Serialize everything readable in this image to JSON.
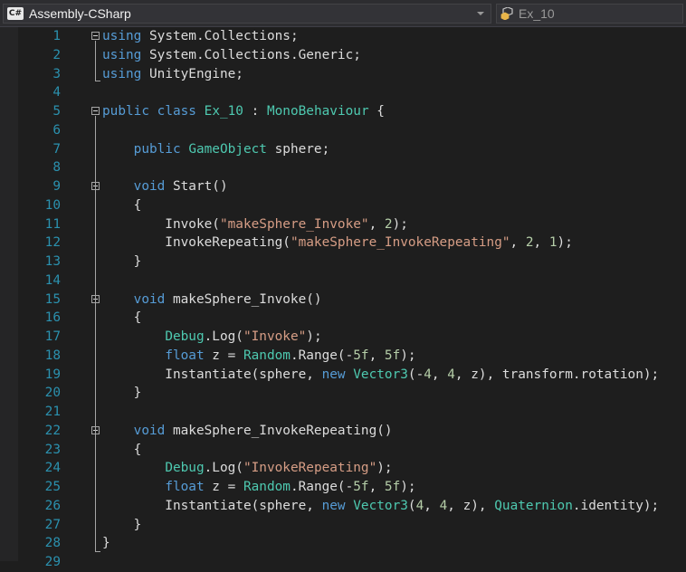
{
  "navbar": {
    "project_icon": "csharp-icon",
    "project_name": "Assembly-CSharp",
    "member_icon": "class-member-icon",
    "member_name": "Ex_10"
  },
  "colors": {
    "background": "#1e1e1e",
    "keyword": "#569cd6",
    "type": "#4ec9b0",
    "string": "#d69d85",
    "number": "#b5cea8",
    "line_number": "#2b91af",
    "text": "#dcdcdc"
  },
  "code_lines": [
    {
      "n": 1,
      "fold": true,
      "tokens": [
        {
          "t": "using",
          "c": "kw"
        },
        {
          "t": " System.Collections;"
        }
      ]
    },
    {
      "n": 2,
      "fold": false,
      "tokens": [
        {
          "t": "using",
          "c": "kw"
        },
        {
          "t": " System.Collections.Generic;"
        }
      ]
    },
    {
      "n": 3,
      "fold": false,
      "tokens": [
        {
          "t": "using",
          "c": "kw"
        },
        {
          "t": " UnityEngine;"
        }
      ]
    },
    {
      "n": 4,
      "fold": false,
      "tokens": []
    },
    {
      "n": 5,
      "fold": true,
      "tokens": [
        {
          "t": "public",
          "c": "kw"
        },
        {
          "t": " "
        },
        {
          "t": "class",
          "c": "kw"
        },
        {
          "t": " "
        },
        {
          "t": "Ex_10",
          "c": "ty"
        },
        {
          "t": " : "
        },
        {
          "t": "MonoBehaviour",
          "c": "ty"
        },
        {
          "t": " {"
        }
      ]
    },
    {
      "n": 6,
      "fold": false,
      "tokens": []
    },
    {
      "n": 7,
      "fold": false,
      "tokens": [
        {
          "t": "    "
        },
        {
          "t": "public",
          "c": "kw"
        },
        {
          "t": " "
        },
        {
          "t": "GameObject",
          "c": "ty"
        },
        {
          "t": " sphere;"
        }
      ]
    },
    {
      "n": 8,
      "fold": false,
      "tokens": []
    },
    {
      "n": 9,
      "fold": true,
      "tokens": [
        {
          "t": "    "
        },
        {
          "t": "void",
          "c": "kw"
        },
        {
          "t": " Start()"
        }
      ]
    },
    {
      "n": 10,
      "fold": false,
      "tokens": [
        {
          "t": "    {"
        }
      ]
    },
    {
      "n": 11,
      "fold": false,
      "tokens": [
        {
          "t": "        Invoke("
        },
        {
          "t": "\"makeSphere_Invoke\"",
          "c": "st"
        },
        {
          "t": ", "
        },
        {
          "t": "2",
          "c": "nu"
        },
        {
          "t": ");"
        }
      ]
    },
    {
      "n": 12,
      "fold": false,
      "tokens": [
        {
          "t": "        InvokeRepeating("
        },
        {
          "t": "\"makeSphere_InvokeRepeating\"",
          "c": "st"
        },
        {
          "t": ", "
        },
        {
          "t": "2",
          "c": "nu"
        },
        {
          "t": ", "
        },
        {
          "t": "1",
          "c": "nu"
        },
        {
          "t": ");"
        }
      ]
    },
    {
      "n": 13,
      "fold": false,
      "tokens": [
        {
          "t": "    }"
        }
      ]
    },
    {
      "n": 14,
      "fold": false,
      "tokens": []
    },
    {
      "n": 15,
      "fold": true,
      "tokens": [
        {
          "t": "    "
        },
        {
          "t": "void",
          "c": "kw"
        },
        {
          "t": " makeSphere_Invoke()"
        }
      ]
    },
    {
      "n": 16,
      "fold": false,
      "tokens": [
        {
          "t": "    {"
        }
      ]
    },
    {
      "n": 17,
      "fold": false,
      "tokens": [
        {
          "t": "        "
        },
        {
          "t": "Debug",
          "c": "ty"
        },
        {
          "t": ".Log("
        },
        {
          "t": "\"Invoke\"",
          "c": "st"
        },
        {
          "t": ");"
        }
      ]
    },
    {
      "n": 18,
      "fold": false,
      "tokens": [
        {
          "t": "        "
        },
        {
          "t": "float",
          "c": "kw"
        },
        {
          "t": " z = "
        },
        {
          "t": "Random",
          "c": "ty"
        },
        {
          "t": ".Range(-"
        },
        {
          "t": "5f",
          "c": "nu"
        },
        {
          "t": ", "
        },
        {
          "t": "5f",
          "c": "nu"
        },
        {
          "t": ");"
        }
      ]
    },
    {
      "n": 19,
      "fold": false,
      "tokens": [
        {
          "t": "        Instantiate(sphere, "
        },
        {
          "t": "new",
          "c": "kw"
        },
        {
          "t": " "
        },
        {
          "t": "Vector3",
          "c": "ty"
        },
        {
          "t": "(-"
        },
        {
          "t": "4",
          "c": "nu"
        },
        {
          "t": ", "
        },
        {
          "t": "4",
          "c": "nu"
        },
        {
          "t": ", z), transform.rotation);"
        }
      ]
    },
    {
      "n": 20,
      "fold": false,
      "tokens": [
        {
          "t": "    }"
        }
      ]
    },
    {
      "n": 21,
      "fold": false,
      "tokens": []
    },
    {
      "n": 22,
      "fold": true,
      "tokens": [
        {
          "t": "    "
        },
        {
          "t": "void",
          "c": "kw"
        },
        {
          "t": " makeSphere_InvokeRepeating()"
        }
      ]
    },
    {
      "n": 23,
      "fold": false,
      "tokens": [
        {
          "t": "    {"
        }
      ]
    },
    {
      "n": 24,
      "fold": false,
      "tokens": [
        {
          "t": "        "
        },
        {
          "t": "Debug",
          "c": "ty"
        },
        {
          "t": ".Log("
        },
        {
          "t": "\"InvokeRepeating\"",
          "c": "st"
        },
        {
          "t": ");"
        }
      ]
    },
    {
      "n": 25,
      "fold": false,
      "tokens": [
        {
          "t": "        "
        },
        {
          "t": "float",
          "c": "kw"
        },
        {
          "t": " z = "
        },
        {
          "t": "Random",
          "c": "ty"
        },
        {
          "t": ".Range(-"
        },
        {
          "t": "5f",
          "c": "nu"
        },
        {
          "t": ", "
        },
        {
          "t": "5f",
          "c": "nu"
        },
        {
          "t": ");"
        }
      ]
    },
    {
      "n": 26,
      "fold": false,
      "tokens": [
        {
          "t": "        Instantiate(sphere, "
        },
        {
          "t": "new",
          "c": "kw"
        },
        {
          "t": " "
        },
        {
          "t": "Vector3",
          "c": "ty"
        },
        {
          "t": "("
        },
        {
          "t": "4",
          "c": "nu"
        },
        {
          "t": ", "
        },
        {
          "t": "4",
          "c": "nu"
        },
        {
          "t": ", z), "
        },
        {
          "t": "Quaternion",
          "c": "ty"
        },
        {
          "t": ".identity);"
        }
      ]
    },
    {
      "n": 27,
      "fold": false,
      "tokens": [
        {
          "t": "    }"
        }
      ]
    },
    {
      "n": 28,
      "fold": false,
      "tokens": [
        {
          "t": "}"
        }
      ]
    },
    {
      "n": 29,
      "fold": false,
      "tokens": []
    }
  ]
}
